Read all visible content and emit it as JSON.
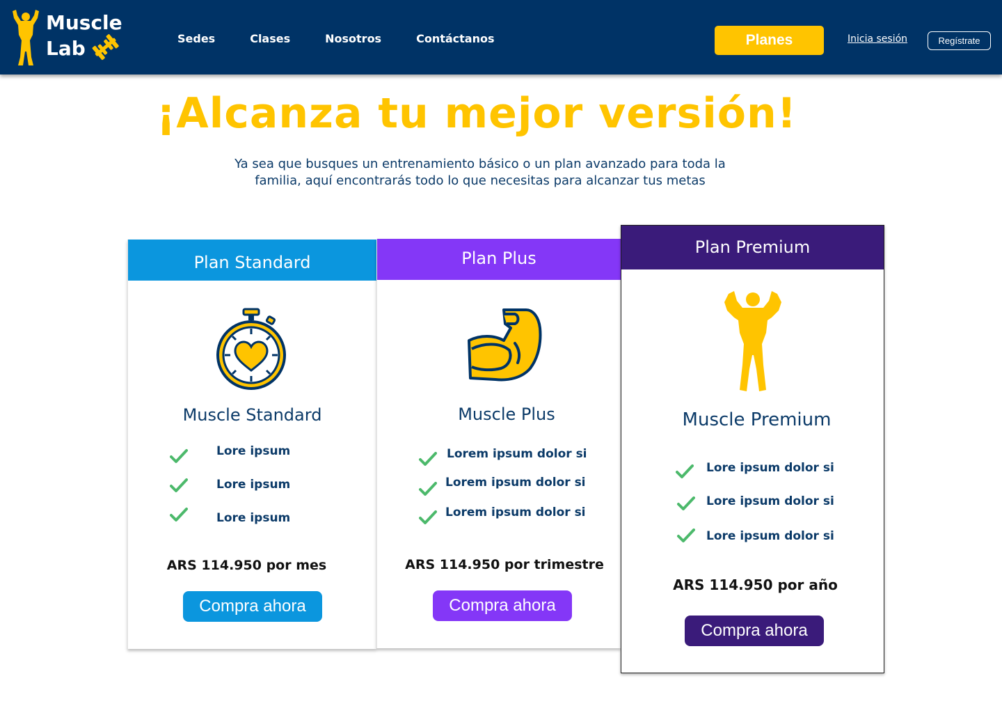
{
  "brand": {
    "line1": "Muscle",
    "line2": "Lab",
    "accent": "#ffc400",
    "header_bg": "#003366"
  },
  "nav": {
    "items": [
      "Sedes",
      "Clases",
      "Nosotros",
      "Contáctanos"
    ]
  },
  "header": {
    "cta": "Planes",
    "login": "Inicia sesión",
    "register": "Regístrate"
  },
  "hero": {
    "title": "¡Alcanza tu mejor versión!",
    "subtitle": "Ya sea que busques un entrenamiento básico o un plan avanzado para toda la familia, aquí encontrarás todo lo que necesitas para alcanzar tus metas"
  },
  "plans": [
    {
      "header": "Plan Standard",
      "icon": "stopwatch-heart-icon",
      "name": "Muscle Standard",
      "features": [
        "Lore ipsum",
        "Lore ipsum",
        "Lore ipsum"
      ],
      "price": "ARS 114.950 por mes",
      "button": "Compra ahora",
      "color": "#0b96de"
    },
    {
      "header": "Plan Plus",
      "icon": "flexed-arm-icon",
      "name": "Muscle Plus",
      "features": [
        "Lorem ipsum dolor si",
        "Lorem ipsum dolor si",
        "Lorem ipsum dolor si"
      ],
      "price": "ARS 114.950 por trimestre",
      "button": "Compra ahora",
      "color": "#8437f7"
    },
    {
      "header": "Plan Premium",
      "icon": "bodybuilder-icon",
      "name": "Muscle Premium",
      "features": [
        "Lore ipsum dolor si",
        "Lore ipsum dolor si",
        "Lore ipsum dolor si"
      ],
      "price": "ARS 114.950 por  año",
      "button": "Compra ahora",
      "color": "#3a1b7a"
    }
  ]
}
